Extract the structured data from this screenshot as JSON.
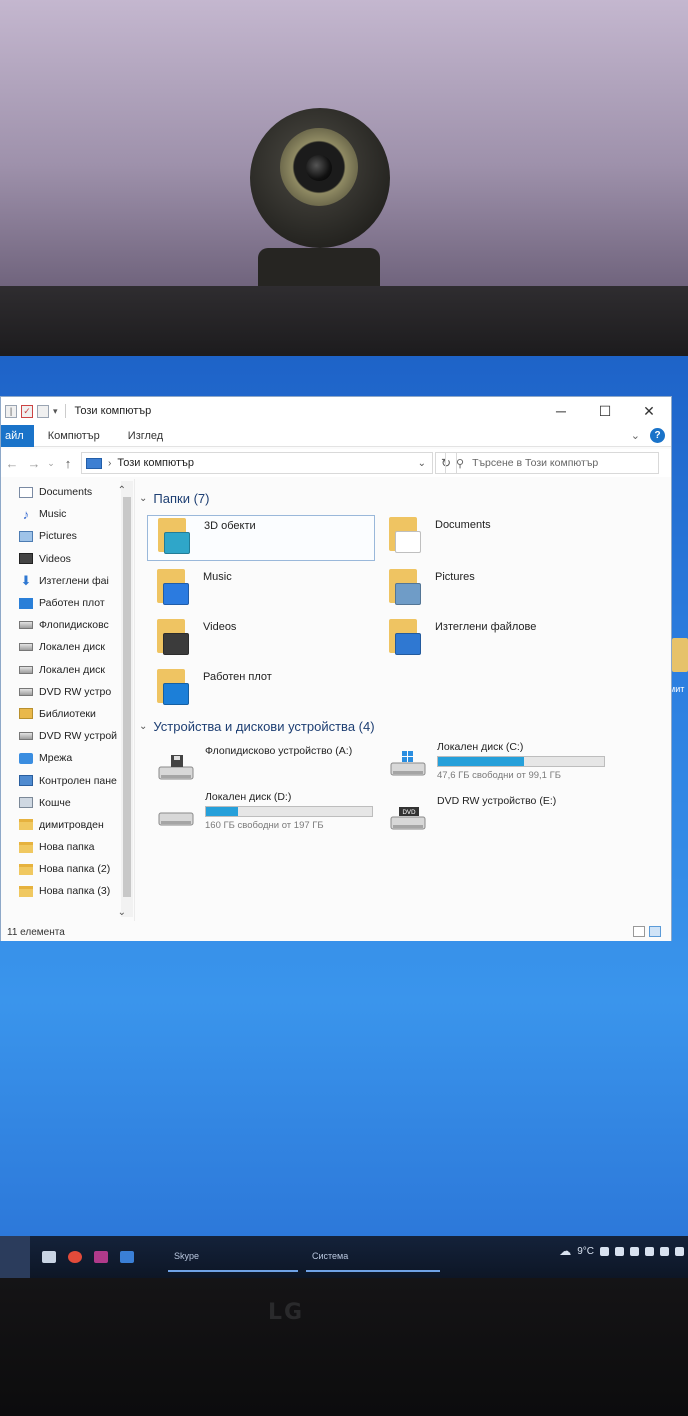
{
  "window": {
    "title": "Този компютър"
  },
  "ribbon": {
    "tabs": [
      "айл",
      "Компютър",
      "Изглед"
    ]
  },
  "address": {
    "path": "Този компютър",
    "search_placeholder": "Търсене в Този компютър"
  },
  "nav_pane": {
    "items": [
      {
        "label": "Documents",
        "icon": "documents-icon"
      },
      {
        "label": "Music",
        "icon": "music-icon"
      },
      {
        "label": "Pictures",
        "icon": "pictures-icon"
      },
      {
        "label": "Videos",
        "icon": "videos-icon"
      },
      {
        "label": "Изтеглени фаі",
        "icon": "downloads-icon"
      },
      {
        "label": "Работен плот",
        "icon": "desktop-icon"
      },
      {
        "label": "Флопидисковс",
        "icon": "floppy-drive-icon"
      },
      {
        "label": "Локален диск",
        "icon": "local-disk-icon"
      },
      {
        "label": "Локален диск",
        "icon": "local-disk-icon"
      },
      {
        "label": "DVD RW устро",
        "icon": "dvd-drive-icon"
      },
      {
        "label": "Библиотеки",
        "icon": "libraries-icon"
      },
      {
        "label": "DVD RW устрой",
        "icon": "dvd-drive-icon"
      },
      {
        "label": "Мрежа",
        "icon": "network-icon"
      },
      {
        "label": "Контролен пане",
        "icon": "control-panel-icon"
      },
      {
        "label": "Кошче",
        "icon": "recycle-bin-icon"
      },
      {
        "label": "димитровден",
        "icon": "folder-icon"
      },
      {
        "label": "Нова папка",
        "icon": "folder-icon"
      },
      {
        "label": "Нова папка (2)",
        "icon": "folder-icon"
      },
      {
        "label": "Нова папка (3)",
        "icon": "folder-icon"
      }
    ]
  },
  "folders": {
    "header": "Папки (7)",
    "items": [
      {
        "label": "3D обекти",
        "icon": "3d-objects-icon",
        "accent": "#2fa6c9"
      },
      {
        "label": "Documents",
        "icon": "documents-icon",
        "accent": "#ffffff"
      },
      {
        "label": "Music",
        "icon": "music-icon",
        "accent": "#2b7be0"
      },
      {
        "label": "Pictures",
        "icon": "pictures-icon",
        "accent": "#6f9cc7"
      },
      {
        "label": "Videos",
        "icon": "videos-icon",
        "accent": "#3b3b3b"
      },
      {
        "label": "Изтеглени файлове",
        "icon": "downloads-icon",
        "accent": "#2f78d2"
      },
      {
        "label": "Работен плот",
        "icon": "desktop-icon",
        "accent": "#1c7fd8"
      }
    ]
  },
  "devices": {
    "header": "Устройства и дискови устройства (4)",
    "items": [
      {
        "label": "Флопидисково устройство (A:)",
        "icon": "floppy-drive-icon"
      },
      {
        "label": "Локален диск (C:)",
        "icon": "windows-drive-icon",
        "free_text": "47,6 ГБ свободни от 99,1 ГБ",
        "used_fraction": 0.52
      },
      {
        "label": "Локален диск (D:)",
        "icon": "local-disk-icon",
        "free_text": "160 ГБ свободни от 197 ГБ",
        "used_fraction": 0.19
      },
      {
        "label": "DVD RW устройство (E:)",
        "icon": "dvd-drive-icon"
      }
    ]
  },
  "status": {
    "item_count": "11 елемента"
  },
  "taskbar": {
    "tasks": [
      "Skype",
      "Система"
    ],
    "temperature": "9°C"
  },
  "desktop": {
    "icon_label": "имит"
  },
  "monitor": {
    "brand": "LG"
  },
  "colors": {
    "accent": "#1a73c9",
    "drive_bar": "#26a0da",
    "desktop": "#2c7fe0"
  }
}
